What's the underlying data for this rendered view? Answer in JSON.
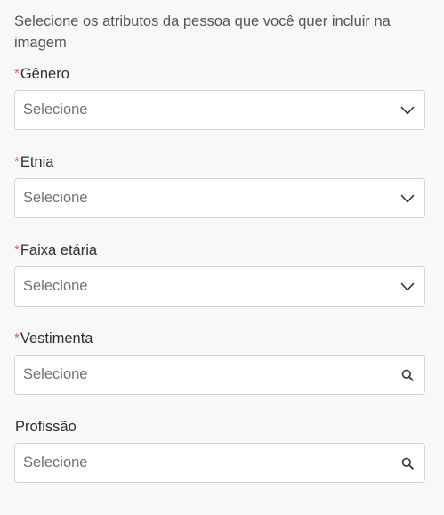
{
  "intro_text": "Selecione os atributos da pessoa que você quer incluir na imagem",
  "fields": [
    {
      "label": "Gênero",
      "required_mark": "*",
      "placeholder": "Selecione",
      "icon": "chevron-down-icon"
    },
    {
      "label": "Etnia",
      "required_mark": "*",
      "placeholder": "Selecione",
      "icon": "chevron-down-icon"
    },
    {
      "label": "Faixa etária",
      "required_mark": "*",
      "placeholder": "Selecione",
      "icon": "chevron-down-icon"
    },
    {
      "label": "Vestimenta",
      "required_mark": "*",
      "placeholder": "Selecione",
      "icon": "search-icon"
    },
    {
      "label": "Profissão",
      "required_mark": "",
      "placeholder": "Selecione",
      "icon": "search-icon"
    }
  ],
  "colors": {
    "background": "#f8f8f8",
    "required": "#e0645f",
    "border": "#d4d4d4",
    "placeholder": "#727272"
  }
}
